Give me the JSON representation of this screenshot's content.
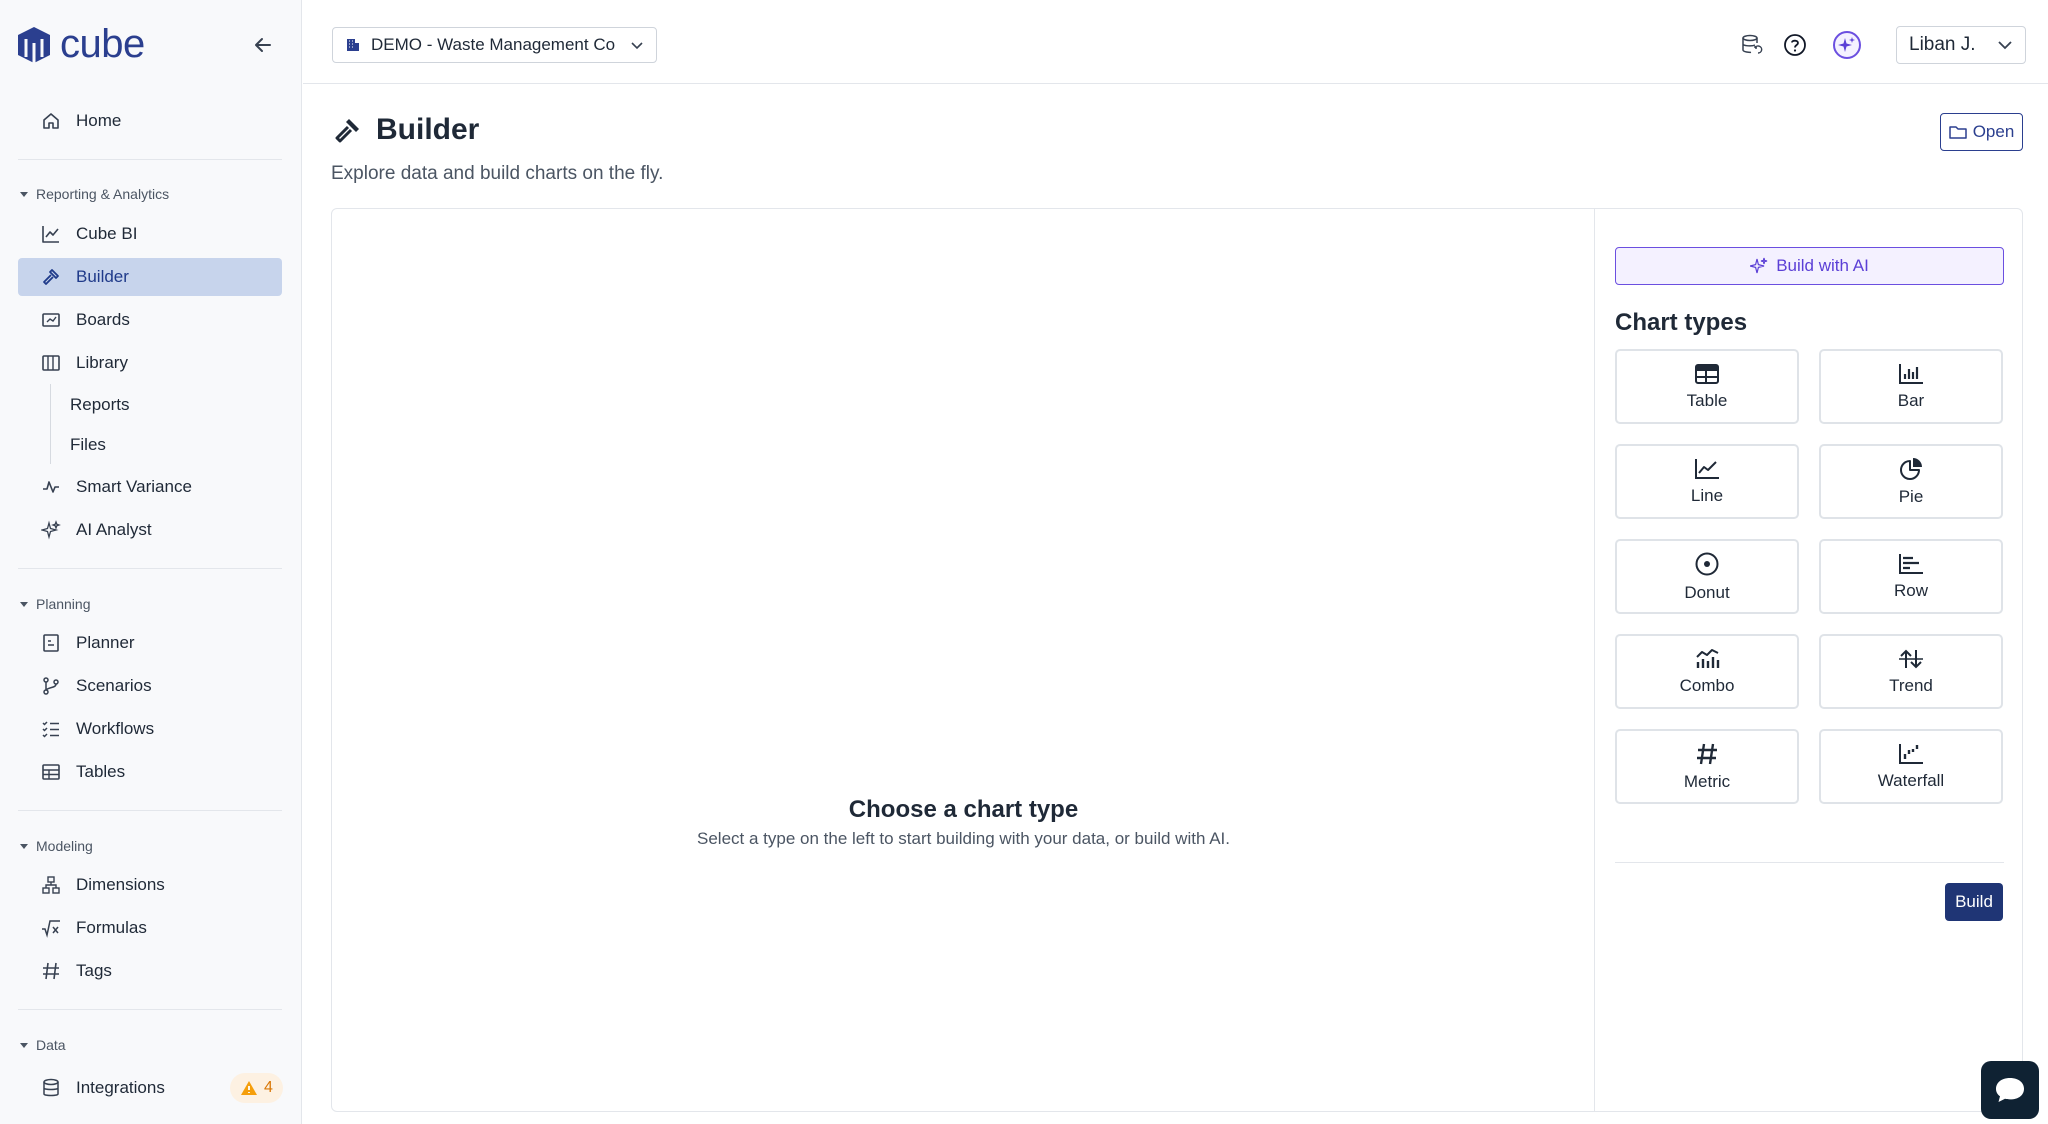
{
  "app": {
    "logo_text": "cube"
  },
  "sidebar": {
    "home": "Home",
    "sections": {
      "reporting": "Reporting & Analytics",
      "planning": "Planning",
      "modeling": "Modeling",
      "data": "Data"
    },
    "items": {
      "cube_bi": "Cube BI",
      "builder": "Builder",
      "boards": "Boards",
      "library": "Library",
      "reports": "Reports",
      "files": "Files",
      "smart_variance": "Smart Variance",
      "ai_analyst": "AI Analyst",
      "planner": "Planner",
      "scenarios": "Scenarios",
      "workflows": "Workflows",
      "tables": "Tables",
      "dimensions": "Dimensions",
      "formulas": "Formulas",
      "tags": "Tags",
      "integrations": "Integrations"
    },
    "integrations_badge": "4"
  },
  "header": {
    "org": "DEMO - Waste Management Co",
    "user": "Liban J."
  },
  "page": {
    "title": "Builder",
    "subtitle": "Explore data and build charts on the fly.",
    "open_label": "Open"
  },
  "canvas": {
    "empty_title": "Choose a chart type",
    "empty_subtitle": "Select a type on the left to start building with your data, or build with AI."
  },
  "side_panel": {
    "ai_button": "Build with AI",
    "types_title": "Chart types",
    "types": [
      "Table",
      "Bar",
      "Line",
      "Pie",
      "Donut",
      "Row",
      "Combo",
      "Trend",
      "Metric",
      "Waterfall"
    ],
    "build_label": "Build"
  },
  "colors": {
    "brand": "#2b3f8f",
    "active_bg": "#c7d4ec",
    "ai_accent": "#6b4fe0",
    "build_btn": "#1f3575",
    "warning": "#d97706"
  }
}
